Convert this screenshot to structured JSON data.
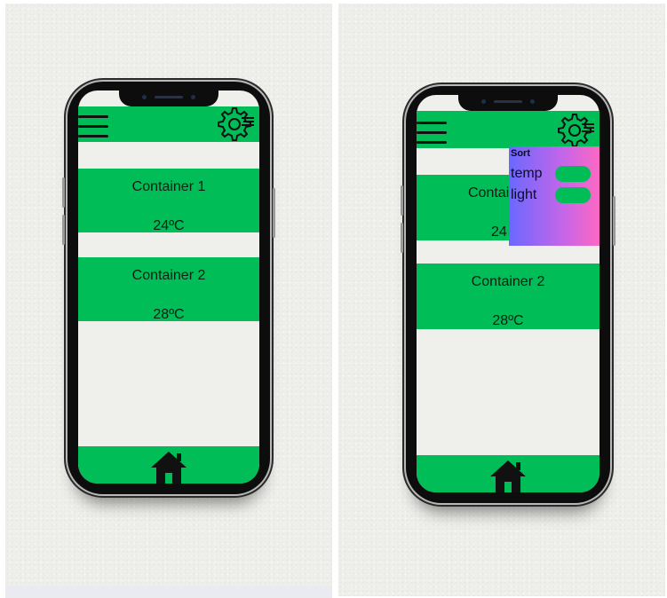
{
  "colors": {
    "accent": "#00bd58",
    "sort_gradient_start": "#6a68ff",
    "sort_gradient_end": "#ff68bf"
  },
  "icons": {
    "menu": "hamburger-menu-icon",
    "settings": "gear-icon",
    "home": "home-icon"
  },
  "left_screen": {
    "containers": [
      {
        "name": "Container 1",
        "temp": "24ºC"
      },
      {
        "name": "Container 2",
        "temp": "28ºC"
      }
    ]
  },
  "right_screen": {
    "containers": [
      {
        "name": "Contai",
        "temp": "24"
      },
      {
        "name": "Container 2",
        "temp": "28ºC"
      }
    ],
    "sort": {
      "title": "Sort",
      "options": [
        {
          "label": "temp",
          "enabled": true
        },
        {
          "label": "light",
          "enabled": true
        }
      ]
    }
  }
}
